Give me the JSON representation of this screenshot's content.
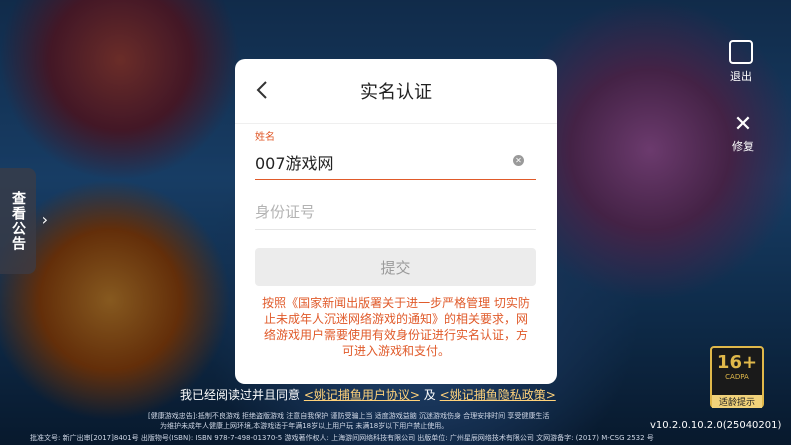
{
  "modal": {
    "title": "实名认证",
    "name_label": "姓名",
    "name_value": "007游戏网",
    "id_placeholder": "身份证号",
    "submit_label": "提交",
    "notice": "按照《国家新闻出版署关于进一步严格管理 切实防止未成年人沉迷网络游戏的通知》的相关要求，网络游戏用户需要使用有效身份证进行实名认证，方可进入游戏和支付。"
  },
  "side": {
    "notice_label": "查看公告",
    "exit_label": "退出",
    "repair_label": "修复"
  },
  "agreement": {
    "prefix": "我已经阅读过并且同意",
    "user_link": "<姚记捕鱼用户协议>",
    "and": "及",
    "privacy_link": "<姚记捕鱼隐私政策>"
  },
  "age_badge": {
    "rating": "16+",
    "org": "CADPA",
    "tip": "适龄提示"
  },
  "footer": {
    "line1": "[健康游戏忠告]:抵制不良游戏 拒绝盗版游戏 注意自我保护 谨防受骗上当 适度游戏益脑 沉迷游戏伤身 合理安排时间 享受健康生活",
    "line2": "为维护未成年人健康上网环境,本游戏适于年满18岁以上用户玩 未满18岁以下用户禁止使用。",
    "line3": "批准文号: 新广出审[2017]8401号 出版物号(ISBN): ISBN 978-7-498-01370-5 游戏著作权人: 上海游间网络科技有限公司 出版单位: 广州星辰网络技术有限公司 文网游备字: (2017) M-CSG 2532 号",
    "version": "v10.2.0.10.2.0(25040201)"
  },
  "colors": {
    "accent": "#e05a2a",
    "link": "#ffd27a"
  }
}
